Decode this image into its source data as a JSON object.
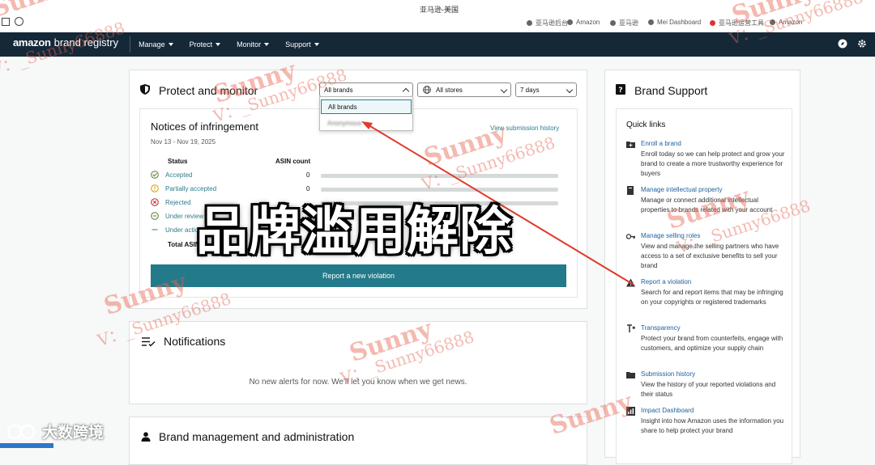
{
  "browser": {
    "tab_title": "亚马逊-美国",
    "bookmarks": [
      "亚马逊后台",
      "Amazon",
      "亚马逊",
      "Mei Dashboard",
      "亚马逊运营工具",
      "Amazon"
    ]
  },
  "topnav": {
    "logo_prefix": "amazon",
    "logo_suffix": "brand registry",
    "items": [
      "Manage",
      "Protect",
      "Monitor",
      "Support"
    ]
  },
  "protect": {
    "title": "Protect and monitor",
    "brand_filter": "All brands",
    "store_filter": "All stores",
    "period_filter": "7 days",
    "dropdown_options": [
      "All brands",
      "Anonymous"
    ]
  },
  "notices": {
    "title": "Notices of infringement",
    "date_range": "Nov 13 - Nov 19, 2025",
    "view_history": "View submission history",
    "col_status": "Status",
    "col_count": "ASIN count",
    "rows": [
      {
        "label": "Accepted",
        "count": "0",
        "fill": 0
      },
      {
        "label": "Partially accepted",
        "count": "0",
        "fill": 0
      },
      {
        "label": "Rejected",
        "count": "0",
        "fill": 0
      },
      {
        "label": "Under review",
        "count": "0",
        "fill": 0
      },
      {
        "label": "Under action",
        "count": "0",
        "fill": 0
      }
    ],
    "total_label": "Total ASINs",
    "report_button": "Report a new violation"
  },
  "overlay_text": "品牌滥用解除",
  "notifications": {
    "title": "Notifications",
    "empty": "No new alerts for now. We'll let you know when we get news."
  },
  "brand_mgmt": {
    "title": "Brand management and administration"
  },
  "brand_support": {
    "title": "Brand Support",
    "quick_links_heading": "Quick links",
    "links": [
      {
        "title": "Enroll a brand",
        "desc": "Enroll today so we can help protect and grow your brand to create a more trustworthy experience for buyers",
        "icon": "add-folder-icon"
      },
      {
        "title": "Manage intellectual property",
        "desc": "Manage or connect additional intellectual properties to brands related with your account",
        "icon": "book-icon"
      },
      {
        "title": "Manage selling roles",
        "desc": "View and manage the selling partners who have access to a set of exclusive benefits to sell your brand",
        "icon": "key-icon"
      },
      {
        "title": "Report a violation",
        "desc": "Search for and report items that may be infringing on your copyrights or registered trademarks",
        "icon": "warning-icon"
      },
      {
        "title": "Transparency",
        "desc": "Protect your brand from counterfeits, engage with customers, and optimize your supply chain",
        "icon": "transparency-icon"
      },
      {
        "title": "Submission history",
        "desc": "View the history of your reported violations and their status",
        "icon": "folder-icon"
      },
      {
        "title": "Impact Dashboard",
        "desc": "Insight into how Amazon uses the information you share to help protect your brand",
        "icon": "dashboard-icon"
      }
    ]
  },
  "watermark": {
    "name": "Sunny",
    "contact": "V：_Sunny66888"
  },
  "corner_logo": "大数跨境",
  "colors": {
    "nav_bg": "#152838",
    "primary_teal": "#237a8a",
    "link_blue": "#2162a1",
    "arrow_red": "#e03a2c"
  }
}
